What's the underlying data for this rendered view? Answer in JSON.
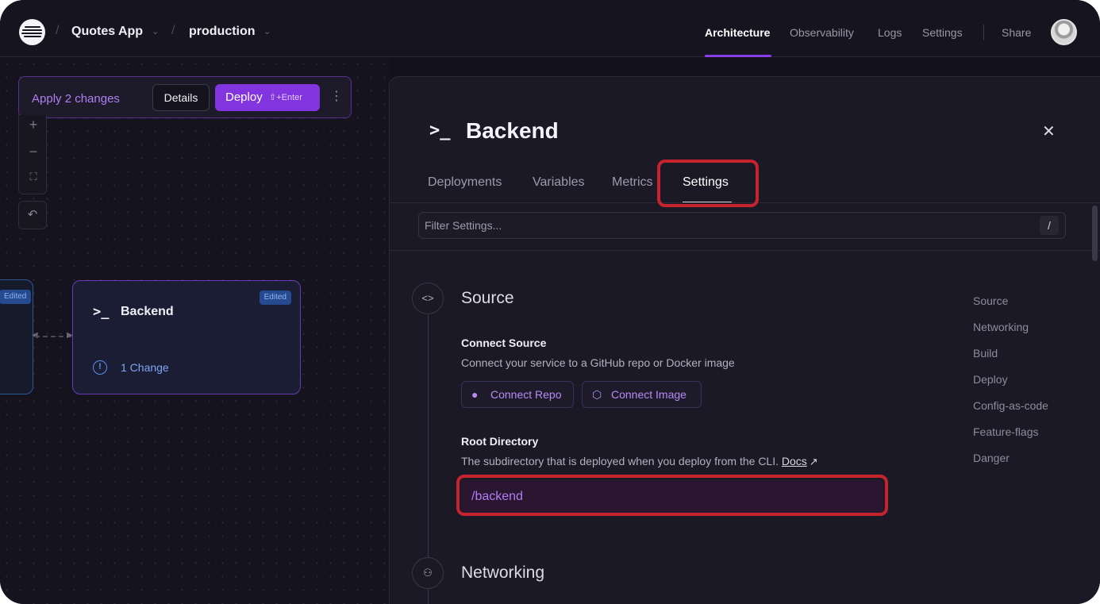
{
  "header": {
    "project": "Quotes App",
    "environment": "production",
    "nav": [
      "Architecture",
      "Observability",
      "Logs",
      "Settings"
    ],
    "share": "Share"
  },
  "canvas": {
    "apply_changes": "Apply 2 changes",
    "details": "Details",
    "deploy": "Deploy",
    "deploy_shortcut": "⇧+Enter",
    "edited_badge": "Edited",
    "left_badge": "Edited",
    "service_title": "Backend",
    "service_changes": "1 Change"
  },
  "panel": {
    "title": "Backend",
    "tabs": [
      "Deployments",
      "Variables",
      "Metrics",
      "Settings"
    ],
    "active_tab": "Settings",
    "filter_placeholder": "Filter Settings...",
    "filter_shortcut": "/",
    "sections": {
      "source": "Source",
      "networking": "Networking"
    },
    "connect_source": {
      "label": "Connect Source",
      "description": "Connect your service to a GitHub repo or Docker image",
      "repo_button": "Connect Repo",
      "image_button": "Connect Image"
    },
    "root_directory": {
      "label": "Root Directory",
      "description": "The subdirectory that is deployed when you deploy from the CLI.",
      "docs_link": "Docs",
      "value": "/backend"
    },
    "side_nav": [
      "Source",
      "Networking",
      "Build",
      "Deploy",
      "Config-as-code",
      "Feature-flags",
      "Danger"
    ]
  },
  "colors": {
    "accent": "#8235de",
    "highlight": "#c5242f",
    "background": "#13111c"
  }
}
